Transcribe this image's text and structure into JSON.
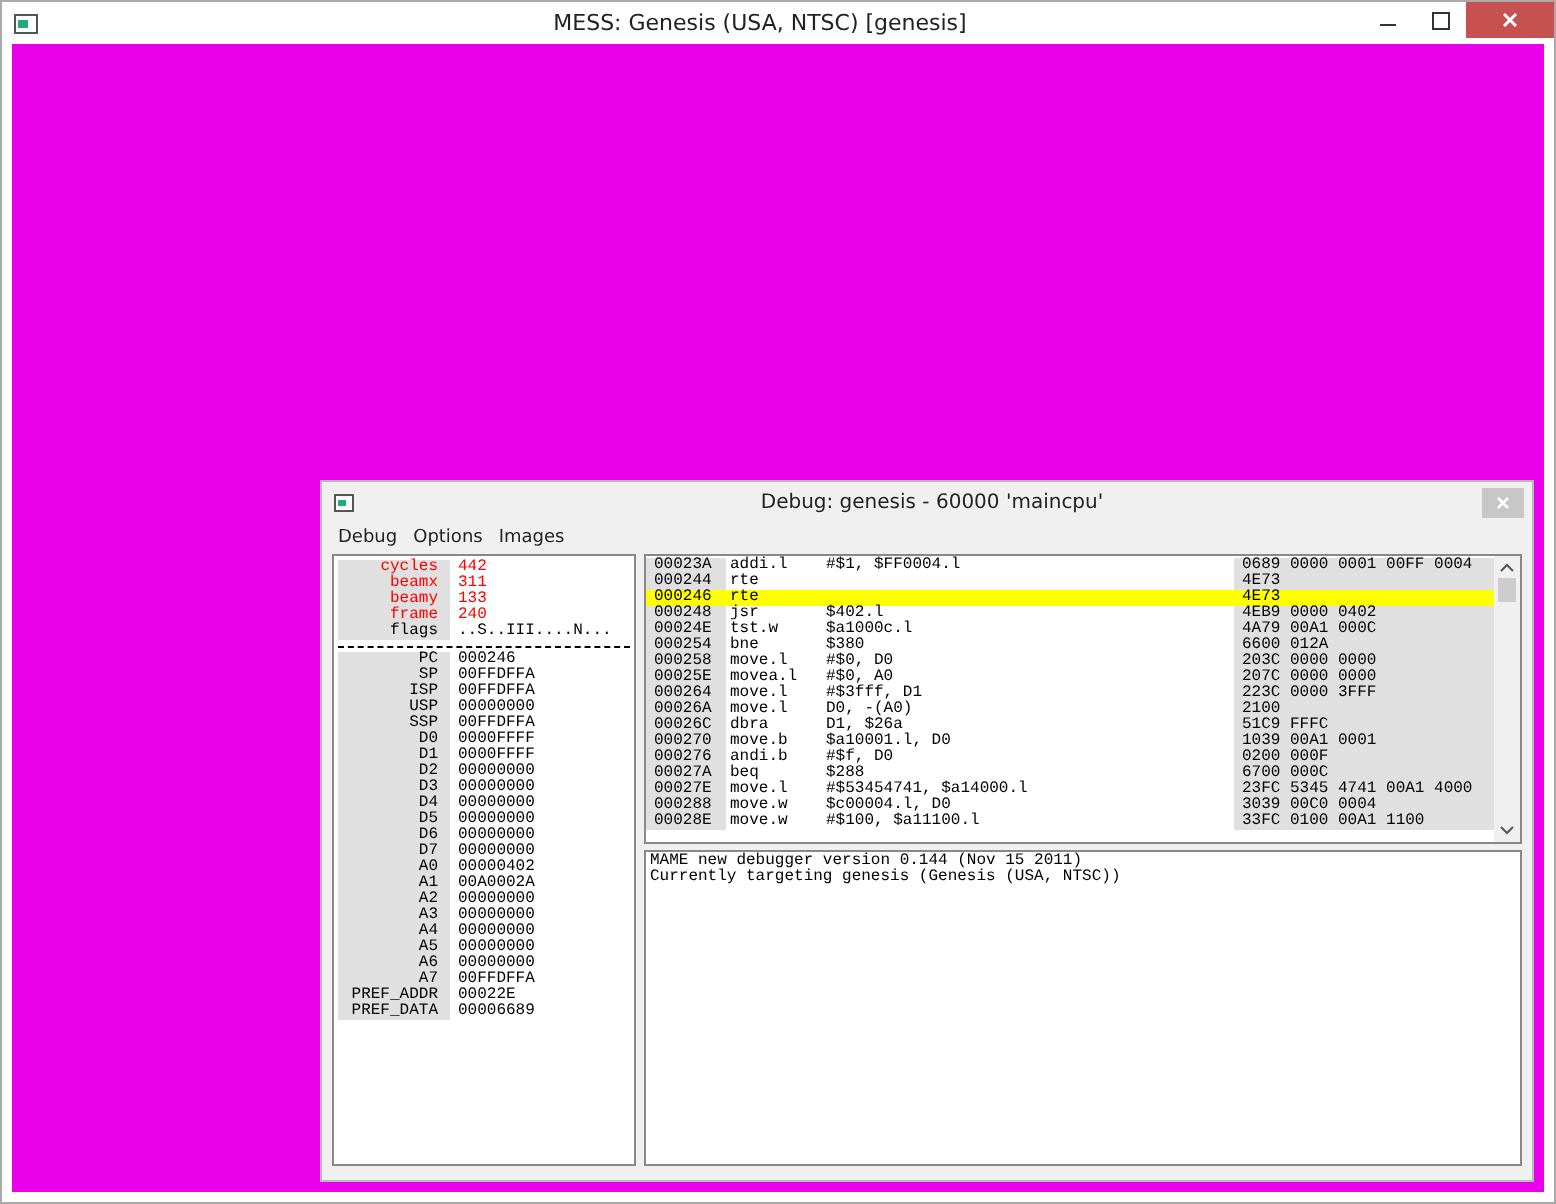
{
  "window": {
    "title": "MESS: Genesis (USA, NTSC) [genesis]"
  },
  "debugger": {
    "title": "Debug: genesis - 60000 'maincpu'",
    "menu": [
      "Debug",
      "Options",
      "Images"
    ],
    "state": [
      {
        "label": "cycles",
        "value": "442",
        "highlighted": true
      },
      {
        "label": "beamx",
        "value": "311",
        "highlighted": true
      },
      {
        "label": "beamy",
        "value": "133",
        "highlighted": true
      },
      {
        "label": "frame",
        "value": "240",
        "highlighted": true
      },
      {
        "label": "flags",
        "value": "..S..III....N...",
        "highlighted": false
      }
    ],
    "registers": [
      {
        "label": "PC",
        "value": "000246"
      },
      {
        "label": "SP",
        "value": "00FFDFFA"
      },
      {
        "label": "ISP",
        "value": "00FFDFFA"
      },
      {
        "label": "USP",
        "value": "00000000"
      },
      {
        "label": "SSP",
        "value": "00FFDFFA"
      },
      {
        "label": "D0",
        "value": "0000FFFF"
      },
      {
        "label": "D1",
        "value": "0000FFFF"
      },
      {
        "label": "D2",
        "value": "00000000"
      },
      {
        "label": "D3",
        "value": "00000000"
      },
      {
        "label": "D4",
        "value": "00000000"
      },
      {
        "label": "D5",
        "value": "00000000"
      },
      {
        "label": "D6",
        "value": "00000000"
      },
      {
        "label": "D7",
        "value": "00000000"
      },
      {
        "label": "A0",
        "value": "00000402"
      },
      {
        "label": "A1",
        "value": "00A0002A"
      },
      {
        "label": "A2",
        "value": "00000000"
      },
      {
        "label": "A3",
        "value": "00000000"
      },
      {
        "label": "A4",
        "value": "00000000"
      },
      {
        "label": "A5",
        "value": "00000000"
      },
      {
        "label": "A6",
        "value": "00000000"
      },
      {
        "label": "A7",
        "value": "00FFDFFA"
      },
      {
        "label": "PREF_ADDR",
        "value": "00022E"
      },
      {
        "label": "PREF_DATA",
        "value": "00006689"
      }
    ],
    "disassembly": [
      {
        "address": "00023A",
        "mnemonic": "addi.l",
        "operands": "#$1, $FF0004.l",
        "bytes": "0689 0000 0001 00FF 0004",
        "current": false
      },
      {
        "address": "000244",
        "mnemonic": "rte",
        "bytes": "4E73",
        "current": false
      },
      {
        "address": "000246",
        "mnemonic": "rte",
        "bytes": "4E73",
        "current": true
      },
      {
        "address": "000248",
        "mnemonic": "jsr",
        "operands": "$402.l",
        "bytes": "4EB9 0000 0402",
        "current": false
      },
      {
        "address": "00024E",
        "mnemonic": "tst.w",
        "operands": "$a1000c.l",
        "bytes": "4A79 00A1 000C",
        "current": false
      },
      {
        "address": "000254",
        "mnemonic": "bne",
        "operands": "$380",
        "bytes": "6600 012A",
        "current": false
      },
      {
        "address": "000258",
        "mnemonic": "move.l",
        "operands": "#$0, D0",
        "bytes": "203C 0000 0000",
        "current": false
      },
      {
        "address": "00025E",
        "mnemonic": "movea.l",
        "operands": "#$0, A0",
        "bytes": "207C 0000 0000",
        "current": false
      },
      {
        "address": "000264",
        "mnemonic": "move.l",
        "operands": "#$3fff, D1",
        "bytes": "223C 0000 3FFF",
        "current": false
      },
      {
        "address": "00026A",
        "mnemonic": "move.l",
        "operands": "D0, -(A0)",
        "bytes": "2100",
        "current": false
      },
      {
        "address": "00026C",
        "mnemonic": "dbra",
        "operands": "D1, $26a",
        "bytes": "51C9 FFFC",
        "current": false
      },
      {
        "address": "000270",
        "mnemonic": "move.b",
        "operands": "$a10001.l, D0",
        "bytes": "1039 00A1 0001",
        "current": false
      },
      {
        "address": "000276",
        "mnemonic": "andi.b",
        "operands": "#$f, D0",
        "bytes": "0200 000F",
        "current": false
      },
      {
        "address": "00027A",
        "mnemonic": "beq",
        "operands": "$288",
        "bytes": "6700 000C",
        "current": false
      },
      {
        "address": "00027E",
        "mnemonic": "move.l",
        "operands": "#$53454741, $a14000.l",
        "bytes": "23FC 5345 4741 00A1 4000",
        "current": false
      },
      {
        "address": "000288",
        "mnemonic": "move.w",
        "operands": "$c00004.l, D0",
        "bytes": "3039 00C0 0004",
        "current": false
      },
      {
        "address": "00028E",
        "mnemonic": "move.w",
        "operands": "#$100, $a11100.l",
        "bytes": "33FC 0100 00A1 1100",
        "current": false
      }
    ],
    "console": [
      "MAME new debugger version 0.144 (Nov 15 2011)",
      "Currently targeting genesis (Genesis (USA, NTSC))"
    ]
  }
}
